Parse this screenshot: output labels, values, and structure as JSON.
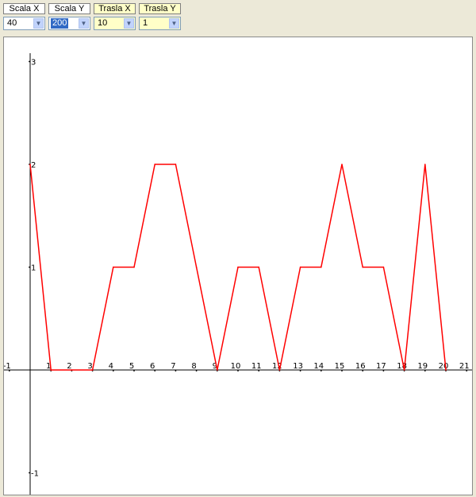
{
  "controls": [
    {
      "label": "Scala X",
      "value": "40",
      "selected": false,
      "highlight": false
    },
    {
      "label": "Scala Y",
      "value": "200",
      "selected": true,
      "highlight": false
    },
    {
      "label": "Trasla X",
      "value": "10",
      "selected": false,
      "highlight": true
    },
    {
      "label": "Trasla Y",
      "value": "1",
      "selected": false,
      "highlight": true
    }
  ],
  "colors": {
    "curve": "#ff0000",
    "axes": "#000000",
    "plot_background": "#ffffff",
    "window_background": "#ece9d8",
    "highlight_control": "#ffffc8",
    "selection": "#316ac5"
  },
  "chart_data": {
    "type": "line",
    "xlim": [
      -1,
      21
    ],
    "ylim": [
      -1,
      3
    ],
    "x_ticks": [
      "-1",
      "1",
      "2",
      "3",
      "4",
      "5",
      "6",
      "7",
      "8",
      "9",
      "10",
      "11",
      "12",
      "13",
      "14",
      "15",
      "16",
      "17",
      "18",
      "19",
      "20",
      "21"
    ],
    "y_ticks": [
      "3",
      "2",
      "1",
      "-1"
    ],
    "grid": false,
    "series": [
      {
        "points": [
          [
            0,
            2
          ],
          [
            1,
            0
          ],
          [
            2,
            0
          ],
          [
            3,
            0
          ],
          [
            4,
            1
          ],
          [
            5,
            1
          ],
          [
            6,
            2
          ],
          [
            7,
            2
          ],
          [
            8,
            1
          ],
          [
            9,
            0
          ],
          [
            10,
            1
          ],
          [
            11,
            1
          ],
          [
            12,
            0
          ],
          [
            13,
            1
          ],
          [
            14,
            1
          ],
          [
            15,
            2
          ],
          [
            16,
            1
          ],
          [
            17,
            1
          ],
          [
            18,
            0
          ],
          [
            19,
            2
          ],
          [
            20,
            0
          ]
        ]
      }
    ]
  }
}
